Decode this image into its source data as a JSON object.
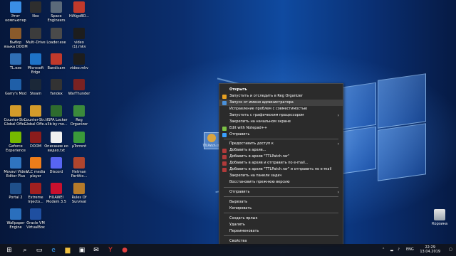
{
  "desktop_icons": [
    {
      "label": "Этот\nкомпьютер",
      "color": "#3a8ee6",
      "icon": "computer-icon"
    },
    {
      "label": "Nox",
      "color": "#2e2e2e",
      "icon": "nox-icon"
    },
    {
      "label": "Space\nEngineers",
      "color": "#5b6a7a",
      "icon": "space-engineers-icon"
    },
    {
      "label": "HiAlgoBO...",
      "color": "#c0392b",
      "icon": "hialgo-icon"
    },
    {
      "label": "Выбор\nязыка DOOM",
      "color": "#8a5a2b",
      "icon": "doom-lang-icon"
    },
    {
      "label": "Multi-Drive",
      "color": "#3c3c3c",
      "icon": "multi-drive-icon"
    },
    {
      "label": "Loader.exe",
      "color": "#4a4a4a",
      "icon": "exe-icon"
    },
    {
      "label": "video (1).mkv",
      "color": "#1d1d1d",
      "icon": "video-file-icon"
    },
    {
      "label": "TL.exe",
      "color": "#2f6fb5",
      "icon": "tl-exe-icon"
    },
    {
      "label": "Microsoft\nEdge",
      "color": "#1e73c8",
      "icon": "edge-icon"
    },
    {
      "label": "Bandicam",
      "color": "#c0392b",
      "icon": "bandicam-icon"
    },
    {
      "label": "video.mkv",
      "color": "#1d1d1d",
      "icon": "video-file-icon"
    },
    {
      "label": "Garry's Mod",
      "color": "#1f5fa8",
      "icon": "gmod-icon"
    },
    {
      "label": "Steam",
      "color": "#1b2838",
      "icon": "steam-icon"
    },
    {
      "label": "Yandex",
      "color": "#333333",
      "icon": "yandex-icon"
    },
    {
      "label": "WarThunder",
      "color": "#7a2222",
      "icon": "warthunder-icon"
    },
    {
      "label": "Counter-Str...\nGlobal Offe...",
      "color": "#d49b2a",
      "icon": "csgo-icon"
    },
    {
      "label": "Counter-Str...\nGlobal Offe...",
      "color": "#d49b2a",
      "icon": "csgo-icon"
    },
    {
      "label": "HSPA Locker\nv3b by mo...",
      "color": "#2e6b2e",
      "icon": "hspa-locker-icon"
    },
    {
      "label": "Reg\nOrganizer",
      "color": "#3b8a3b",
      "icon": "reg-organizer-icon"
    },
    {
      "label": "Geforce\nExperience",
      "color": "#76b900",
      "icon": "geforce-icon"
    },
    {
      "label": "DOOM",
      "color": "#8a1c1c",
      "icon": "doom-icon"
    },
    {
      "label": "Описание ко\nвидео.txt",
      "color": "#f0f0f0",
      "icon": "text-file-icon"
    },
    {
      "label": "µTorrent",
      "color": "#3a9a3a",
      "icon": "utorrent-icon"
    },
    {
      "label": "Movavi Video\nEditor Plus",
      "color": "#2f74c0",
      "icon": "movavi-icon"
    },
    {
      "label": "VLC media\nplayer",
      "color": "#ee7d1a",
      "icon": "vlc-icon"
    },
    {
      "label": "Discord",
      "color": "#5865f2",
      "icon": "discord-icon"
    },
    {
      "label": "Hetman\nPartitio...",
      "color": "#b0452e",
      "icon": "hetman-icon"
    },
    {
      "label": "Portal 2",
      "color": "#1f4f8a",
      "icon": "portal2-icon"
    },
    {
      "label": "Extreme\nInjecto...",
      "color": "#a02020",
      "icon": "injector-icon"
    },
    {
      "label": "HUAWEI\nModem 3.5",
      "color": "#c8102e",
      "icon": "huawei-icon"
    },
    {
      "label": "Rules Of\nSurvival",
      "color": "#b57a2a",
      "icon": "ros-icon"
    },
    {
      "label": "Wallpaper\nEngine",
      "color": "#2a6fbd",
      "icon": "wallpaper-engine-icon"
    },
    {
      "label": "Oracle VM\nVirtualBox",
      "color": "#1f4fa0",
      "icon": "virtualbox-icon"
    }
  ],
  "dragged_file": {
    "label": "TTLPatch.rar",
    "icon": "rar-archive-icon"
  },
  "context_menu": {
    "items": [
      {
        "label": "Открыть",
        "bold": true,
        "icon": ""
      },
      {
        "label": "Запустить и отследить в Reg Organizer",
        "icon": "reg-organizer-icon",
        "icon_color": "#e6a021"
      },
      {
        "label": "Запуск от имени администратора",
        "icon": "shield-icon",
        "icon_color": "#4a90d9",
        "highlighted": true
      },
      {
        "label": "Исправление проблем с совместимостью",
        "icon": ""
      },
      {
        "label": "Запустить с графическим процессором",
        "icon": "",
        "submenu": true
      },
      {
        "label": "Закрепить на начальном экране",
        "icon": ""
      },
      {
        "label": "Edit with Notepad++",
        "icon": "notepad-plus-icon",
        "icon_color": "#7cc144"
      },
      {
        "label": "Отправить",
        "icon": "send-icon",
        "icon_color": "#3aa0ff"
      },
      {
        "label": "Предоставить доступ к",
        "icon": "",
        "submenu": true
      },
      {
        "label": "Добавить в архив...",
        "icon": "winrar-icon",
        "icon_color": "#b03a3a"
      },
      {
        "label": "Добавить в архив \"TTLPatch.rar\"",
        "icon": "winrar-icon",
        "icon_color": "#b03a3a"
      },
      {
        "label": "Добавить в архив и отправить по e-mail...",
        "icon": "winrar-icon",
        "icon_color": "#b03a3a"
      },
      {
        "label": "Добавить в архив \"TTLPatch.rar\" и отправить по e-mail",
        "icon": "winrar-icon",
        "icon_color": "#b03a3a"
      },
      {
        "label": "Закрепить на панели задач",
        "icon": ""
      },
      {
        "label": "Восстановить прежнюю версию",
        "icon": ""
      },
      {
        "label": "Отправить",
        "icon": "",
        "submenu": true
      },
      {
        "label": "Вырезать",
        "icon": ""
      },
      {
        "label": "Копировать",
        "icon": ""
      },
      {
        "label": "Создать ярлык",
        "icon": ""
      },
      {
        "label": "Удалить",
        "icon": ""
      },
      {
        "label": "Переименовать",
        "icon": ""
      },
      {
        "label": "Свойства",
        "icon": ""
      }
    ]
  },
  "recycle_bin": {
    "label": "Корзина"
  },
  "taskbar": {
    "apps": [
      "start-icon",
      "search-icon",
      "task-view-icon",
      "edge-icon",
      "explorer-icon",
      "store-icon",
      "mail-icon",
      "yandex-icon",
      "bandicam-icon"
    ],
    "tray_lang": "ENG",
    "time": "22:29",
    "date": "13.04.2019"
  }
}
